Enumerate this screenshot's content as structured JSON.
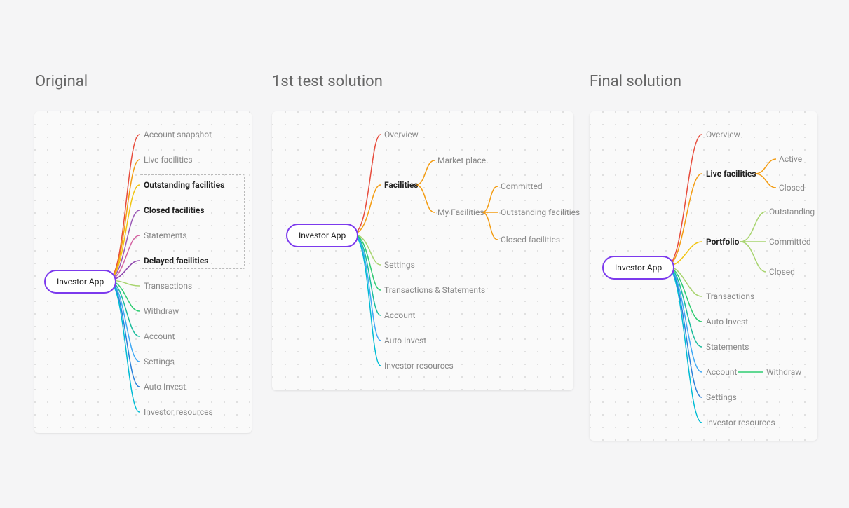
{
  "titles": {
    "original": "Original",
    "first": "1st test solution",
    "final": "Final solution"
  },
  "root": "Investor App",
  "colors": {
    "red": "#e74c3c",
    "orange": "#f39c12",
    "amber": "#f1c40f",
    "violet": "#9b59b6",
    "purple": "#8e44ad",
    "magenta": "#d35fa0",
    "lime": "#a8d46f",
    "green": "#2ecc71",
    "teal": "#1abc9c",
    "sky": "#3fa9f5",
    "blue": "#2980d9",
    "cyan": "#00bcd4"
  },
  "original": {
    "items": [
      {
        "label": "Account snapshot",
        "bold": false
      },
      {
        "label": "Live facilities",
        "bold": false
      },
      {
        "label": "Outstanding facilities",
        "bold": true
      },
      {
        "label": "Closed facilities",
        "bold": true
      },
      {
        "label": "Statements",
        "bold": false
      },
      {
        "label": "Delayed facilities",
        "bold": true
      },
      {
        "label": "Transactions",
        "bold": false
      },
      {
        "label": "Withdraw",
        "bold": false
      },
      {
        "label": "Account",
        "bold": false
      },
      {
        "label": "Settings",
        "bold": false
      },
      {
        "label": "Auto Invest",
        "bold": false
      },
      {
        "label": "Investor resources",
        "bold": false
      }
    ]
  },
  "first": {
    "level1": [
      {
        "label": "Overview",
        "bold": false
      },
      {
        "label": "Facilities",
        "bold": true
      },
      {
        "label": "Settings",
        "bold": false
      },
      {
        "label": "Transactions & Statements",
        "bold": false
      },
      {
        "label": "Account",
        "bold": false
      },
      {
        "label": "Auto Invest",
        "bold": false
      },
      {
        "label": "Investor resources",
        "bold": false
      }
    ],
    "facilities_children": [
      {
        "label": "Market place",
        "bold": false
      },
      {
        "label": "My Facilities",
        "bold": false
      }
    ],
    "myfacilities_children": [
      {
        "label": "Committed",
        "bold": false
      },
      {
        "label": "Outstanding facilities",
        "bold": false
      },
      {
        "label": "Closed facilities",
        "bold": false
      }
    ]
  },
  "final": {
    "level1": [
      {
        "label": "Overview",
        "bold": false
      },
      {
        "label": "Live facilities",
        "bold": true
      },
      {
        "label": "Portfolio",
        "bold": true
      },
      {
        "label": "Transactions",
        "bold": false
      },
      {
        "label": "Auto Invest",
        "bold": false
      },
      {
        "label": "Statements",
        "bold": false
      },
      {
        "label": "Account",
        "bold": false
      },
      {
        "label": "Settings",
        "bold": false
      },
      {
        "label": "Investor resources",
        "bold": false
      }
    ],
    "live_children": [
      {
        "label": "Active",
        "bold": false
      },
      {
        "label": "Closed",
        "bold": false
      }
    ],
    "portfolio_children": [
      {
        "label": "Outstanding",
        "bold": false
      },
      {
        "label": "Committed",
        "bold": false
      },
      {
        "label": "Closed",
        "bold": false
      }
    ],
    "account_children": [
      {
        "label": "Withdraw",
        "bold": false
      }
    ]
  }
}
